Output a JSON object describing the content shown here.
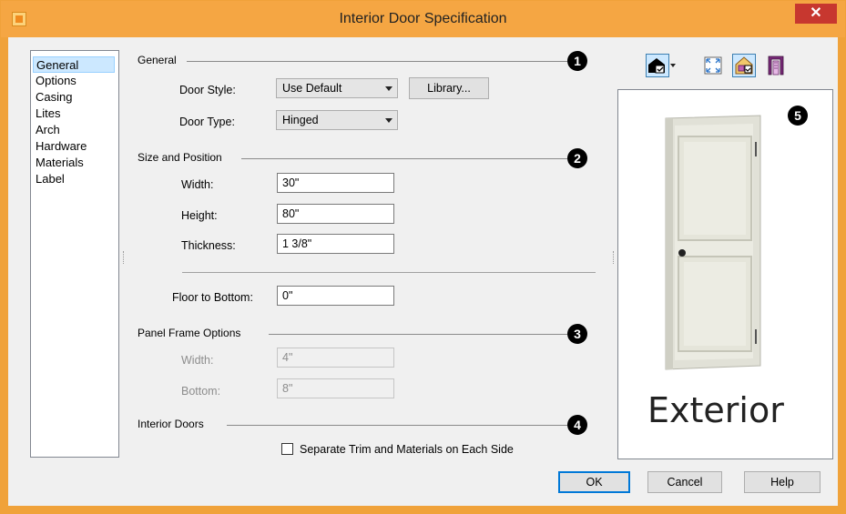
{
  "window": {
    "title": "Interior Door Specification",
    "close_glyph": "✕"
  },
  "nav": {
    "items": [
      "General",
      "Options",
      "Casing",
      "Lites",
      "Arch",
      "Hardware",
      "Materials",
      "Label"
    ],
    "selected": "General"
  },
  "general": {
    "heading": "General",
    "badge": "1",
    "door_style_label": "Door Style:",
    "door_style_value": "Use Default",
    "library_button": "Library...",
    "door_type_label": "Door Type:",
    "door_type_value": "Hinged"
  },
  "size": {
    "heading": "Size and Position",
    "badge": "2",
    "width_label": "Width:",
    "width_value": "30\"",
    "height_label": "Height:",
    "height_value": "80\"",
    "thickness_label": "Thickness:",
    "thickness_value": "1 3/8\"",
    "floor_label": "Floor to Bottom:",
    "floor_value": "0\""
  },
  "panel": {
    "heading": "Panel Frame Options",
    "badge": "3",
    "width_label": "Width:",
    "width_value": "4\"",
    "bottom_label": "Bottom:",
    "bottom_value": "8\""
  },
  "interior": {
    "heading": "Interior Doors",
    "badge": "4",
    "separate_label": "Separate Trim and Materials on Each Side",
    "separate_checked": false
  },
  "preview": {
    "badge": "5",
    "caption": "Exterior"
  },
  "toolbar": {
    "icons": [
      "view-camera-icon",
      "fit-view-icon",
      "house-color-icon",
      "door-frame-icon"
    ]
  },
  "buttons": {
    "ok": "OK",
    "cancel": "Cancel",
    "help": "Help"
  },
  "colors": {
    "titlebar": "#f5a643",
    "close": "#c7372f",
    "selection": "#cce8ff",
    "door": "#e1e1d7"
  }
}
